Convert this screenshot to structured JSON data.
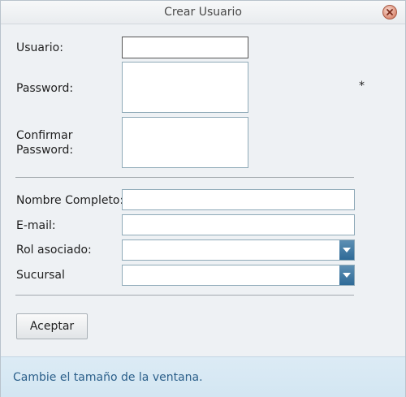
{
  "window": {
    "title": "Crear Usuario"
  },
  "form": {
    "usuario": {
      "label": "Usuario:",
      "value": ""
    },
    "password": {
      "label": "Password:",
      "value": "",
      "required_mark": "*"
    },
    "confirmar": {
      "label_line1": "Confirmar",
      "label_line2": "Password:",
      "value": ""
    },
    "nombre": {
      "label": "Nombre Completo:",
      "value": ""
    },
    "email": {
      "label": "E-mail:",
      "value": ""
    },
    "rol": {
      "label": "Rol asociado:",
      "selected": ""
    },
    "sucursal": {
      "label": "Sucursal",
      "selected": ""
    },
    "submit_label": "Aceptar"
  },
  "status": {
    "text": "Cambie el tamaño de la ventana."
  },
  "icons": {
    "close": "close-icon",
    "dropdown": "chevron-down-icon"
  },
  "colors": {
    "status_text": "#2b5f8a",
    "dropdown_accent": "#3a77a3",
    "close_button": "#dc8e78"
  }
}
